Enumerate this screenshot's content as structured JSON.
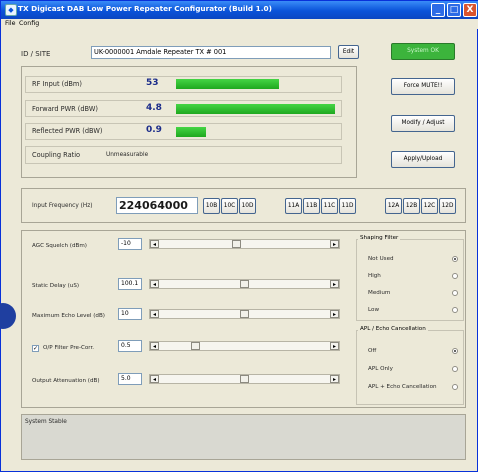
{
  "window": {
    "title": "TX Digicast DAB Low Power Repeater Configurator  (Build 1.0)",
    "minimize_glyph": "_",
    "maximize_glyph": "□",
    "close_glyph": "X",
    "app_icon": "app-icon"
  },
  "menu": [
    "File",
    "Config"
  ],
  "id_site": {
    "label": "ID / SITE",
    "value": "UK-0000001   Amdale Repeater TX # 001",
    "edit_button": "Edit",
    "status_button": "System OK"
  },
  "meters": {
    "rf_input": {
      "label": "RF Input (dBm)",
      "value": "53",
      "level": 0.62
    },
    "forward_pwr": {
      "label": "Forward  PWR (dBW)",
      "value": "4.8",
      "level": 0.96
    },
    "reflected_pwr": {
      "label": "Reflected PWR (dBW)",
      "value": "0.9",
      "level": 0.18
    },
    "coupling": {
      "label": "Coupling Ratio",
      "value": "Unmeasurable"
    }
  },
  "action_buttons": {
    "force_mute": "Force MUTE!!",
    "modify_adjust": "Modify / Adjust",
    "apply_upload": "Apply/Upload"
  },
  "frequency": {
    "label": "Input Frequency (Hz)",
    "value": "224064000",
    "channels": [
      "10B",
      "10C",
      "10D",
      "11A",
      "11B",
      "11C",
      "11D",
      "12A",
      "12B",
      "12C",
      "12D"
    ]
  },
  "controls": {
    "agc_squelch": {
      "label": "AGC Squelch (dBm)",
      "value": "-10",
      "level": 0.45
    },
    "static_delay": {
      "label": "Static Delay (uS)",
      "value": "100.1",
      "level": 0.5
    },
    "max_echo": {
      "label": "Maximum Echo Level (dB)",
      "value": "10",
      "level": 0.5
    },
    "op_filter": {
      "label": "O/P Filter Pre-Corr.",
      "value": "0.5",
      "level": 0.2,
      "checked": true,
      "check_glyph": "✓"
    },
    "output_atten": {
      "label": "Output Attenuation (dB)",
      "value": "5.0",
      "level": 0.5
    }
  },
  "shaping_filter": {
    "title": "Shaping Filter",
    "options": [
      "Not Used",
      "High",
      "Medium",
      "Low"
    ],
    "selected": 0
  },
  "apl_echo": {
    "title": "APL / Echo Cancellation",
    "options": [
      "Off",
      "APL Only",
      "APL + Echo Cancellation"
    ],
    "selected": 0
  },
  "status": {
    "text": "System Stable"
  },
  "colors": {
    "accent_blue": "#0a53d9",
    "bar_green": "#2bbf2b",
    "status_ok": "#3cb43c",
    "marker_blue": "#1f3fa0"
  }
}
